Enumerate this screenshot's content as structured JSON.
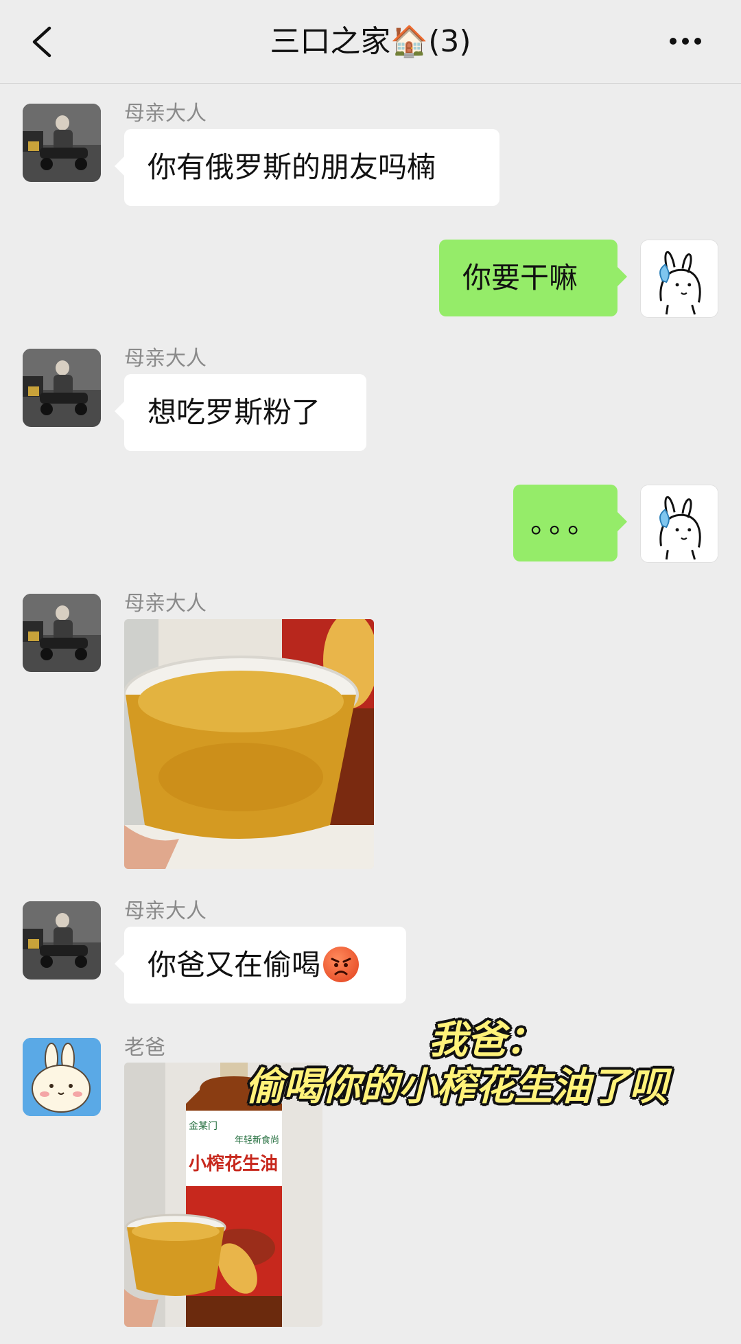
{
  "header": {
    "back_icon": "chevron-left-icon",
    "title": "三口之家🏠(3)",
    "more_icon": "more-dots-icon"
  },
  "messages": [
    {
      "sender": "母亲大人",
      "type": "text",
      "text": "你有俄罗斯的朋友吗楠"
    },
    {
      "sender": "me",
      "type": "text",
      "text": "你要干嘛"
    },
    {
      "sender": "母亲大人",
      "type": "text",
      "text": "想吃罗斯粉了"
    },
    {
      "sender": "me",
      "type": "text",
      "text": "。。。"
    },
    {
      "sender": "母亲大人",
      "type": "image",
      "description_icon": "photo-oil-bowl"
    },
    {
      "sender": "母亲大人",
      "type": "text",
      "text": "你爸又在偷喝",
      "emoji": "angry-face-icon"
    },
    {
      "sender": "老爸",
      "type": "image",
      "description_icon": "photo-peanut-oil-bottle"
    }
  ],
  "product_label": {
    "brand": "金某门",
    "tag": "年轻新食尚",
    "name": "小榨花生油"
  },
  "overlay_caption": {
    "line1": "我爸：",
    "line2": "偷喝你的小榨花生油了呗"
  },
  "colors": {
    "background": "#ededed",
    "incoming_bubble": "#ffffff",
    "outgoing_bubble": "#95ec69",
    "caption": "#fff27a"
  }
}
